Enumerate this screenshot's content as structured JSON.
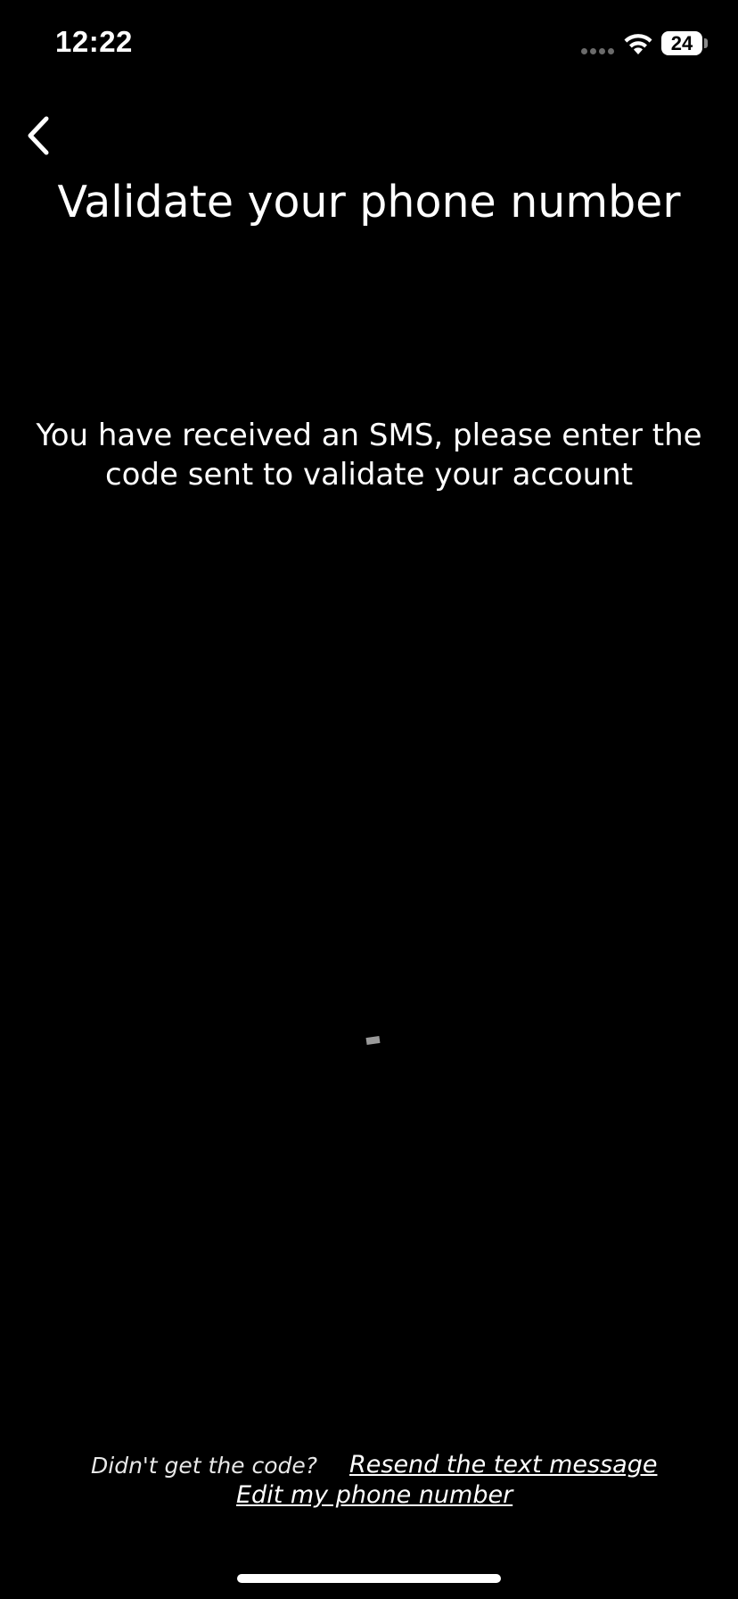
{
  "status_bar": {
    "time": "12:22",
    "battery_level": "24",
    "icons": [
      "signal-dots-icon",
      "wifi-icon",
      "battery-icon"
    ]
  },
  "navigation": {
    "back_icon": "chevron-left-icon"
  },
  "header": {
    "title": "Validate your phone number"
  },
  "main": {
    "instructions_line1": "You have received an SMS, please enter the",
    "instructions_line2": "code sent to validate your account"
  },
  "footer": {
    "question": "Didn't get the code?",
    "resend_label": "Resend the text message",
    "edit_label": "Edit my phone number"
  },
  "colors": {
    "background": "#000000",
    "text": "#ffffff",
    "muted": "#6b6b6b"
  }
}
